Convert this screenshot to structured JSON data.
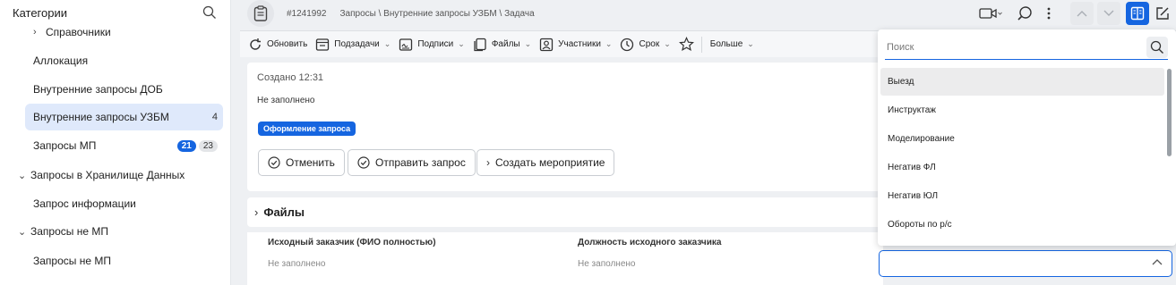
{
  "sidebar": {
    "title": "Категории",
    "items": [
      {
        "label": "Справочники"
      },
      {
        "label": "Аллокация"
      },
      {
        "label": "Внутренние запросы ДОБ"
      },
      {
        "label": "Внутренние запросы УЗБМ",
        "count": "4"
      },
      {
        "label": "Запросы МП",
        "count_new": "21",
        "count_total": "23"
      },
      {
        "label": "Запросы в Хранилище Данных"
      },
      {
        "label": "Запрос информации"
      },
      {
        "label": "Запросы не МП"
      },
      {
        "label": "Запросы не МП"
      }
    ]
  },
  "header": {
    "task_id": "#1241992",
    "breadcrumb": "Запросы \\ Внутренние запросы УЗБМ \\ Задача"
  },
  "toolbar": {
    "refresh": "Обновить",
    "subtasks": "Подзадачи",
    "signatures": "Подписи",
    "files": "Файлы",
    "participants": "Участники",
    "deadline": "Срок",
    "more": "Больше"
  },
  "card": {
    "created": "Создано 12:31",
    "description": "Не заполнено",
    "status": "Оформление запроса",
    "actions": {
      "cancel": "Отменить",
      "send": "Отправить запрос",
      "create_event": "Создать мероприятие"
    }
  },
  "files_section": {
    "title": "Файлы"
  },
  "fields": [
    {
      "label": "Исходный заказчик (ФИО полностью)",
      "value": "Не заполнено"
    },
    {
      "label": "Должность исходного заказчика",
      "value": "Не заполнено"
    }
  ],
  "dropdown": {
    "search_placeholder": "Поиск",
    "options": [
      "Выезд",
      "Инструктаж",
      "Моделирование",
      "Негатив ФЛ",
      "Негатив ЮЛ",
      "Обороты по р/с"
    ]
  },
  "colors": {
    "accent": "#1565e0",
    "active_bg": "#dfe9fb"
  }
}
